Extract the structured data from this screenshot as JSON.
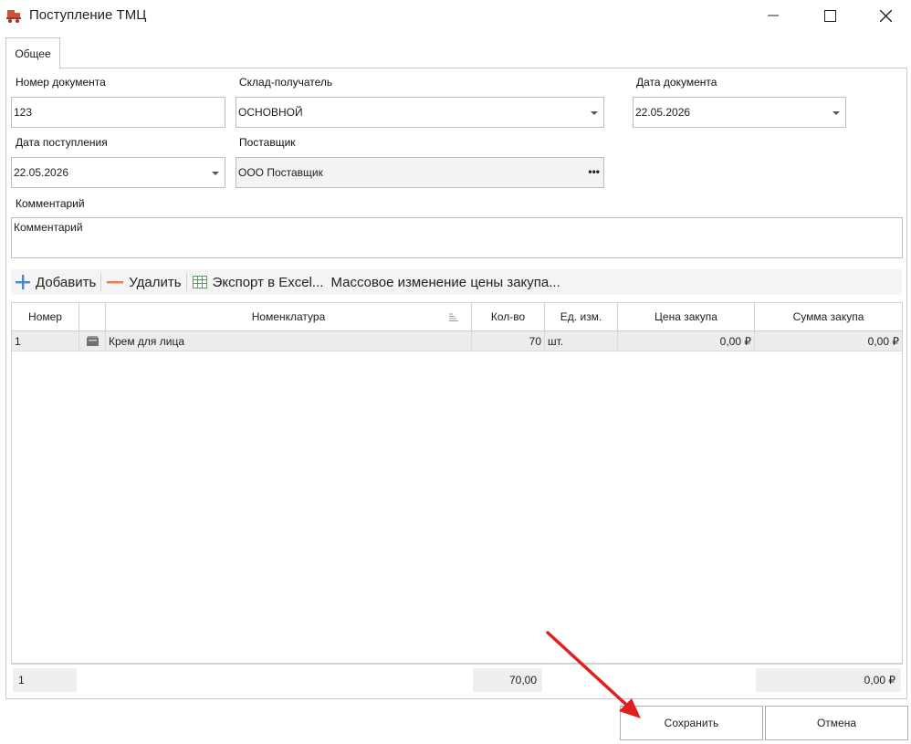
{
  "window": {
    "title": "Поступление ТМЦ"
  },
  "tabs": [
    {
      "label": "Общее"
    }
  ],
  "form": {
    "doc_number": {
      "label": "Номер документа",
      "value": "123"
    },
    "warehouse": {
      "label": "Склад-получатель",
      "value": "ОСНОВНОЙ"
    },
    "doc_date": {
      "label": "Дата документа",
      "value": "22.05.2026"
    },
    "receipt_date": {
      "label": "Дата поступления",
      "value": "22.05.2026"
    },
    "supplier": {
      "label": "Поставщик",
      "value": "ООО Поставщик"
    },
    "comment": {
      "label": "Комментарий",
      "value": "Комментарий"
    }
  },
  "toolbar": {
    "add": "Добавить",
    "delete": "Удалить",
    "export": "Экспорт в Excel...",
    "mass_price": "Массовое изменение цены закупа..."
  },
  "table": {
    "columns": [
      "Номер",
      "",
      "Номенклатура",
      "Кол-во",
      "Ед. изм.",
      "Цена закупа",
      "Сумма закупа"
    ],
    "rows": [
      {
        "number": "1",
        "item": "Крем для лица",
        "qty": "70",
        "unit": "шт.",
        "price": "0,00 ₽",
        "sum": "0,00 ₽"
      }
    ]
  },
  "summary": {
    "count": "1",
    "qty_total": "70,00",
    "sum_total": "0,00 ₽"
  },
  "buttons": {
    "save": "Сохранить",
    "cancel": "Отмена"
  },
  "colors": {
    "add_icon": "#4a86c5",
    "delete_icon": "#e8785a",
    "arrow": "#e02020",
    "app_icon": "#c8553d"
  }
}
